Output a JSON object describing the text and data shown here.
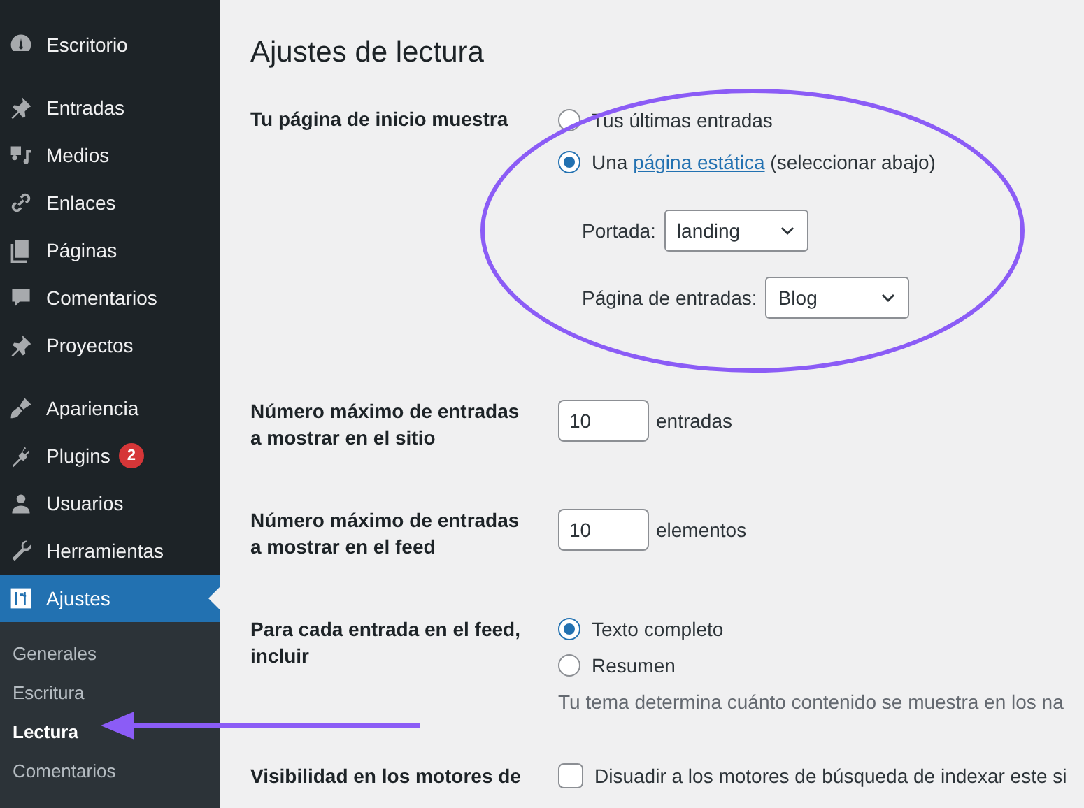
{
  "sidebar": {
    "groups": [
      [
        {
          "label": "Escritorio",
          "selected": false
        }
      ],
      [
        {
          "label": "Entradas",
          "selected": false
        },
        {
          "label": "Medios",
          "selected": false
        },
        {
          "label": "Enlaces",
          "selected": false
        },
        {
          "label": "Páginas",
          "selected": false
        },
        {
          "label": "Comentarios",
          "selected": false
        },
        {
          "label": "Proyectos",
          "selected": false
        }
      ],
      [
        {
          "label": "Apariencia",
          "selected": false
        },
        {
          "label": "Plugins",
          "selected": false,
          "badge": "2"
        },
        {
          "label": "Usuarios",
          "selected": false
        },
        {
          "label": "Herramientas",
          "selected": false
        },
        {
          "label": "Ajustes",
          "selected": true
        }
      ]
    ],
    "submenu": [
      {
        "label": "Generales",
        "selected": false
      },
      {
        "label": "Escritura",
        "selected": false
      },
      {
        "label": "Lectura",
        "selected": true
      },
      {
        "label": "Comentarios",
        "selected": false
      }
    ]
  },
  "page": {
    "title": "Ajustes de lectura",
    "rows": [
      {
        "kind": "front-page",
        "label": "Tu página de inicio muestra",
        "options": [
          {
            "text": "Tus últimas entradas",
            "selected": false
          },
          {
            "text": "Una ",
            "link": "página estática",
            "after": " (seleccionar abajo)",
            "selected": true
          }
        ],
        "selects": [
          {
            "label": "Portada:",
            "value": "landing"
          },
          {
            "label": "Página de entradas:",
            "value": "Blog"
          }
        ]
      },
      {
        "kind": "number",
        "label": "Número máximo de entradas a mostrar en el sitio",
        "value": "10",
        "unit": "entradas"
      },
      {
        "kind": "number",
        "label": "Número máximo de entradas a mostrar en el feed",
        "value": "10",
        "unit": "elementos"
      },
      {
        "kind": "radios",
        "label": "Para cada entrada en el feed, incluir",
        "options": [
          {
            "text": "Texto completo",
            "selected": true
          },
          {
            "text": "Resumen",
            "selected": false
          }
        ],
        "description": "Tu tema determina cuánto contenido se muestra en los na"
      },
      {
        "kind": "checkbox",
        "label": "Visibilidad en los motores de",
        "checked": false,
        "text": "Disuadir a los motores de búsqueda de indexar este si"
      }
    ]
  }
}
